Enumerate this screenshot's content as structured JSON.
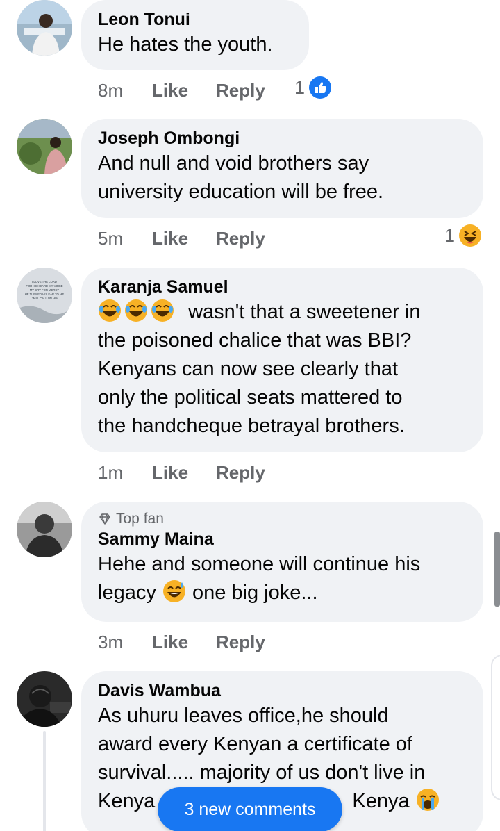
{
  "comments": [
    {
      "author": "Leon Tonui",
      "lines": [
        "He hates the youth."
      ],
      "time": "8m",
      "like": "Like",
      "reply": "Reply",
      "reaction_count": "1",
      "reaction_icon": "like-icon"
    },
    {
      "author": "Joseph Ombongi",
      "lines": [
        "And null and void brothers say",
        "university education will be free."
      ],
      "time": "5m",
      "like": "Like",
      "reply": "Reply",
      "reaction_count": "1",
      "reaction_icon": "haha-icon"
    },
    {
      "author": "Karanja Samuel",
      "lines": [
        "wasn't that a sweetener in",
        "the poisoned chalice that was BBI?",
        "Kenyans can now see clearly that",
        "only the political seats mattered to",
        "the handcheque betrayal brothers."
      ],
      "time": "1m",
      "like": "Like",
      "reply": "Reply"
    },
    {
      "badge": "Top fan",
      "author": "Sammy Maina",
      "lines": [
        "Hehe and someone will continue his",
        "legacy",
        "one big joke..."
      ],
      "time": "3m",
      "like": "Like",
      "reply": "Reply"
    },
    {
      "author": "Davis Wambua",
      "lines": [
        "As uhuru leaves office,he should",
        "award every Kenyan a certificate of",
        "survival..... majority of us don't live in",
        "Kenya",
        "Kenya"
      ]
    }
  ],
  "avatar_text": {
    "karanja": "I LOVE THE LORD FOR HE HEARD MY VOICE. HE HEARD MY CRY FOR MERCY. BECAUSE HE TURNED HIS EAR TO ME, I WILL CALL ON HIM AS LONG AS I LIVE"
  },
  "new_comments_label": "3 new comments",
  "colors": {
    "bubble": "#f0f2f5",
    "secondary_text": "#65676b",
    "accent": "#1877f2"
  }
}
